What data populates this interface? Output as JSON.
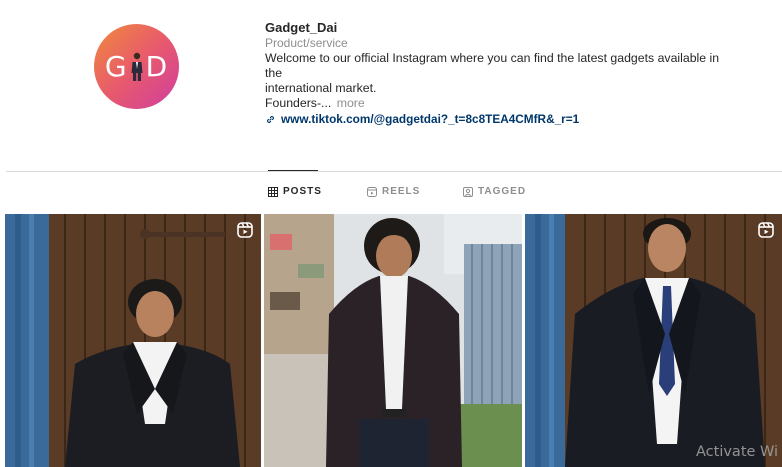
{
  "profile": {
    "logo_letters": [
      "G",
      "D"
    ],
    "username": "Gadget_Dai",
    "category": "Product/service",
    "bio_line1": "Welcome to our official Instagram where you can find the latest gadgets available in the",
    "bio_line2": "international market.",
    "bio_line3": "Founders-...",
    "more_label": "more",
    "link": "www.tiktok.com/@gadgetdai?_t=8c8TEA4CMfR&_r=1",
    "brand_gradient": [
      "#f08a3c",
      "#e85a6c",
      "#cf3ea0"
    ]
  },
  "tabs": [
    {
      "label": "POSTS",
      "icon": "grid-icon",
      "active": true
    },
    {
      "label": "REELS",
      "icon": "reels-icon",
      "active": false
    },
    {
      "label": "TAGGED",
      "icon": "tagged-icon",
      "active": false
    }
  ],
  "posts": [
    {
      "kind": "reel",
      "icon": "reel-badge-icon"
    },
    {
      "kind": "photo"
    },
    {
      "kind": "reel",
      "icon": "reel-badge-icon"
    }
  ],
  "watermark": "Activate Wi"
}
